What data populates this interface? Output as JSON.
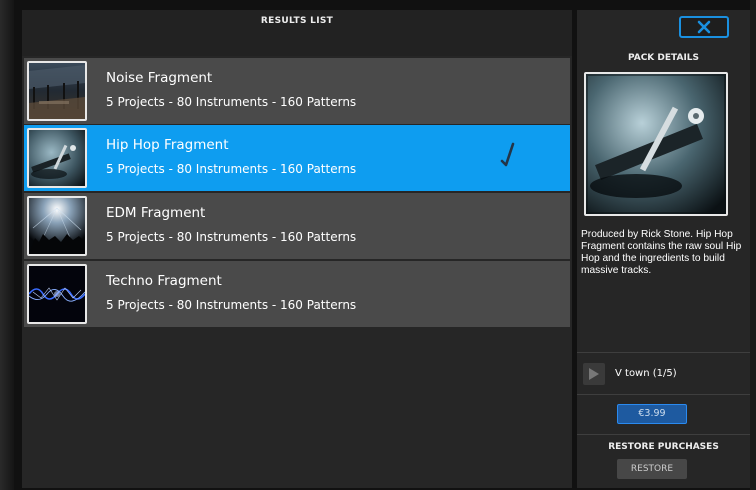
{
  "results": {
    "title": "RESULTS LIST",
    "items": [
      {
        "name": "Noise Fragment",
        "meta": "5 Projects - 80 Instruments - 160 Patterns",
        "selected": false
      },
      {
        "name": "Hip Hop Fragment",
        "meta": "5 Projects - 80 Instruments - 160 Patterns",
        "selected": true
      },
      {
        "name": "EDM Fragment",
        "meta": "5 Projects - 80 Instruments - 160 Patterns",
        "selected": false
      },
      {
        "name": "Techno Fragment",
        "meta": "5 Projects - 80 Instruments - 160 Patterns",
        "selected": false
      }
    ]
  },
  "details": {
    "title": "PACK DETAILS",
    "description": "Produced by Rick Stone. Hip Hop Fragment contains the raw soul Hip Hop and the ingredients to build massive tracks.",
    "track": "V town (1/5)",
    "price": "€3.99",
    "restore_title": "RESTORE PURCHASES",
    "restore_label": "RESTORE"
  },
  "icons": {
    "close": "close-icon",
    "play": "play-icon",
    "check": "checkmark-icon"
  },
  "colors": {
    "accent": "#0e9df0",
    "row": "#4a4a4a",
    "panel": "#262626"
  }
}
